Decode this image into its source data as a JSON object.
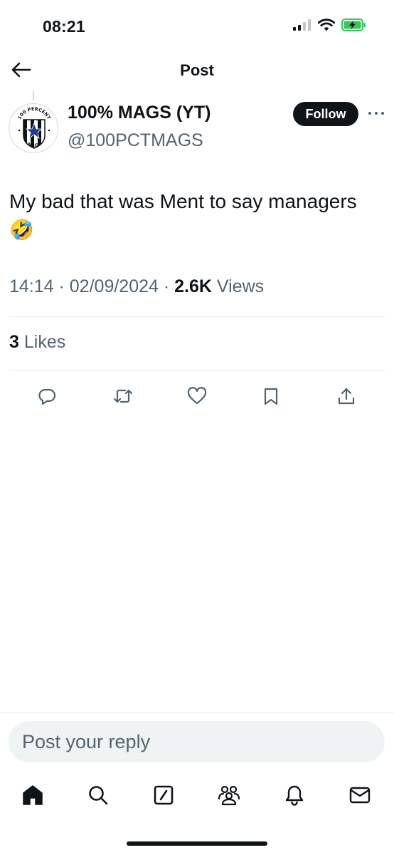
{
  "status_bar": {
    "time": "08:21"
  },
  "header": {
    "title": "Post"
  },
  "author": {
    "display_name": "100% MAGS (YT)",
    "handle": "@100PCTMAGS",
    "follow_label": "Follow",
    "avatar_icon": "100-percent-mags-crest-icon",
    "avatar_text_top": "100 PERCENT",
    "avatar_text_bottom": "MAGS"
  },
  "post": {
    "text": "My bad that was Ment to say managers",
    "emoji": "🤣",
    "time": "14:14",
    "date": "02/09/2024",
    "views_count": "2.6K",
    "views_label": "Views",
    "likes_count": "3",
    "likes_label": "Likes"
  },
  "actions": [
    {
      "name": "reply",
      "icon": "reply-bubble-icon"
    },
    {
      "name": "repost",
      "icon": "repost-icon"
    },
    {
      "name": "like",
      "icon": "heart-icon"
    },
    {
      "name": "bookmark",
      "icon": "bookmark-icon"
    },
    {
      "name": "share",
      "icon": "share-icon"
    }
  ],
  "reply": {
    "placeholder": "Post your reply"
  },
  "tabbar": {
    "items": [
      "home",
      "search",
      "grok",
      "communities",
      "notifications",
      "messages"
    ]
  },
  "colors": {
    "text_primary": "#0f1419",
    "text_secondary": "#536471",
    "divider": "#e6ecf0",
    "reply_bg": "#eff3f4",
    "battery_green": "#34c759"
  }
}
